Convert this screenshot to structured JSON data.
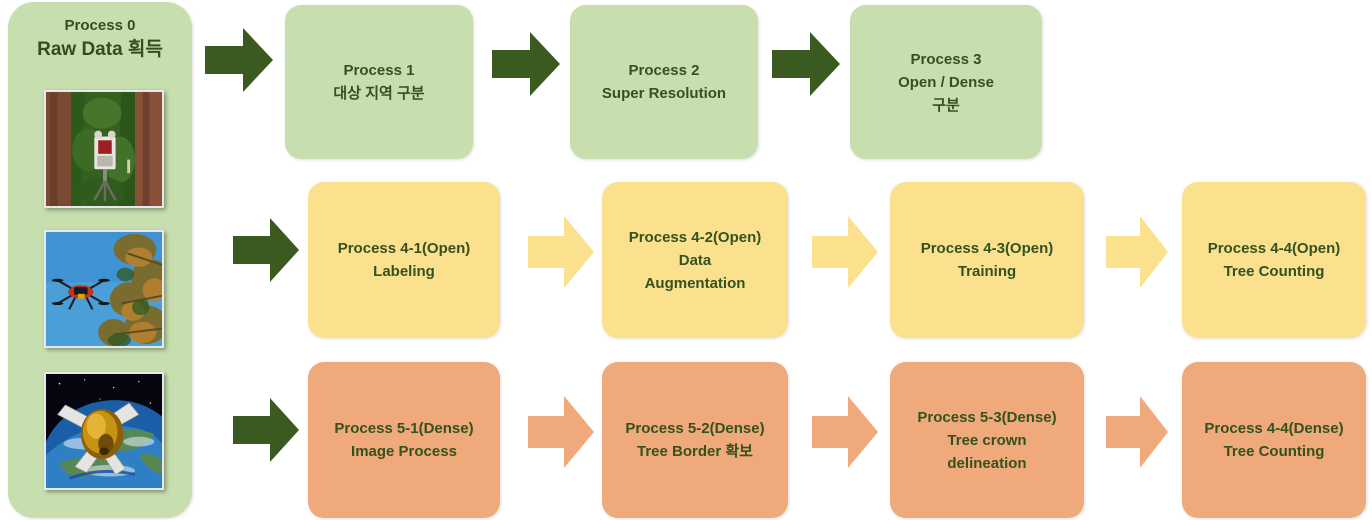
{
  "colors": {
    "green_fill": "#c7dfae",
    "yellow_fill": "#fbe08e",
    "orange_fill": "#f0a97a",
    "dark_green_arrow": "#3a5a20",
    "text": "#33521f",
    "background": "#ffffff"
  },
  "panel": {
    "title_line1": "Process 0",
    "title_line2": "Raw Data 획득",
    "photos": [
      {
        "name": "terrestrial-lidar-scanner-in-redwood-forest"
      },
      {
        "name": "drone-flying-near-pine-trees"
      },
      {
        "name": "satellite-orbiting-earth"
      }
    ]
  },
  "rows": [
    {
      "id": "row-green",
      "color": "green",
      "boxes": [
        {
          "label": "Process 1\n대상 지역 구분"
        },
        {
          "label": "Process 2\nSuper Resolution"
        },
        {
          "label": "Process 3\nOpen / Dense\n구분"
        }
      ]
    },
    {
      "id": "row-open",
      "color": "yellow",
      "boxes": [
        {
          "label": "Process 4-1(Open)\nLabeling"
        },
        {
          "label": "Process 4-2(Open)\nData\nAugmentation"
        },
        {
          "label": "Process 4-3(Open)\nTraining"
        },
        {
          "label": "Process 4-4(Open)\nTree Counting"
        }
      ]
    },
    {
      "id": "row-dense",
      "color": "orange",
      "boxes": [
        {
          "label": "Process 5-1(Dense)\nImage Process"
        },
        {
          "label": "Process 5-2(Dense)\nTree Border 확보"
        },
        {
          "label": "Process 5-3(Dense)\nTree crown\ndelineation"
        },
        {
          "label": "Process 4-4(Dense)\nTree Counting"
        }
      ]
    }
  ],
  "arrows": [
    {
      "name": "arrow-panel-to-process1",
      "color": "#3a5a20"
    },
    {
      "name": "arrow-process1-to-process2",
      "color": "#3a5a20"
    },
    {
      "name": "arrow-process2-to-process3",
      "color": "#3a5a20"
    },
    {
      "name": "arrow-panel-to-process41",
      "color": "#3a5a20"
    },
    {
      "name": "arrow-process41-to-process42",
      "color": "#fbe08e"
    },
    {
      "name": "arrow-process42-to-process43",
      "color": "#fbe08e"
    },
    {
      "name": "arrow-process43-to-process44",
      "color": "#fbe08e"
    },
    {
      "name": "arrow-panel-to-process51",
      "color": "#3a5a20"
    },
    {
      "name": "arrow-process51-to-process52",
      "color": "#f0a97a"
    },
    {
      "name": "arrow-process52-to-process53",
      "color": "#f0a97a"
    },
    {
      "name": "arrow-process53-to-process54",
      "color": "#f0a97a"
    }
  ]
}
